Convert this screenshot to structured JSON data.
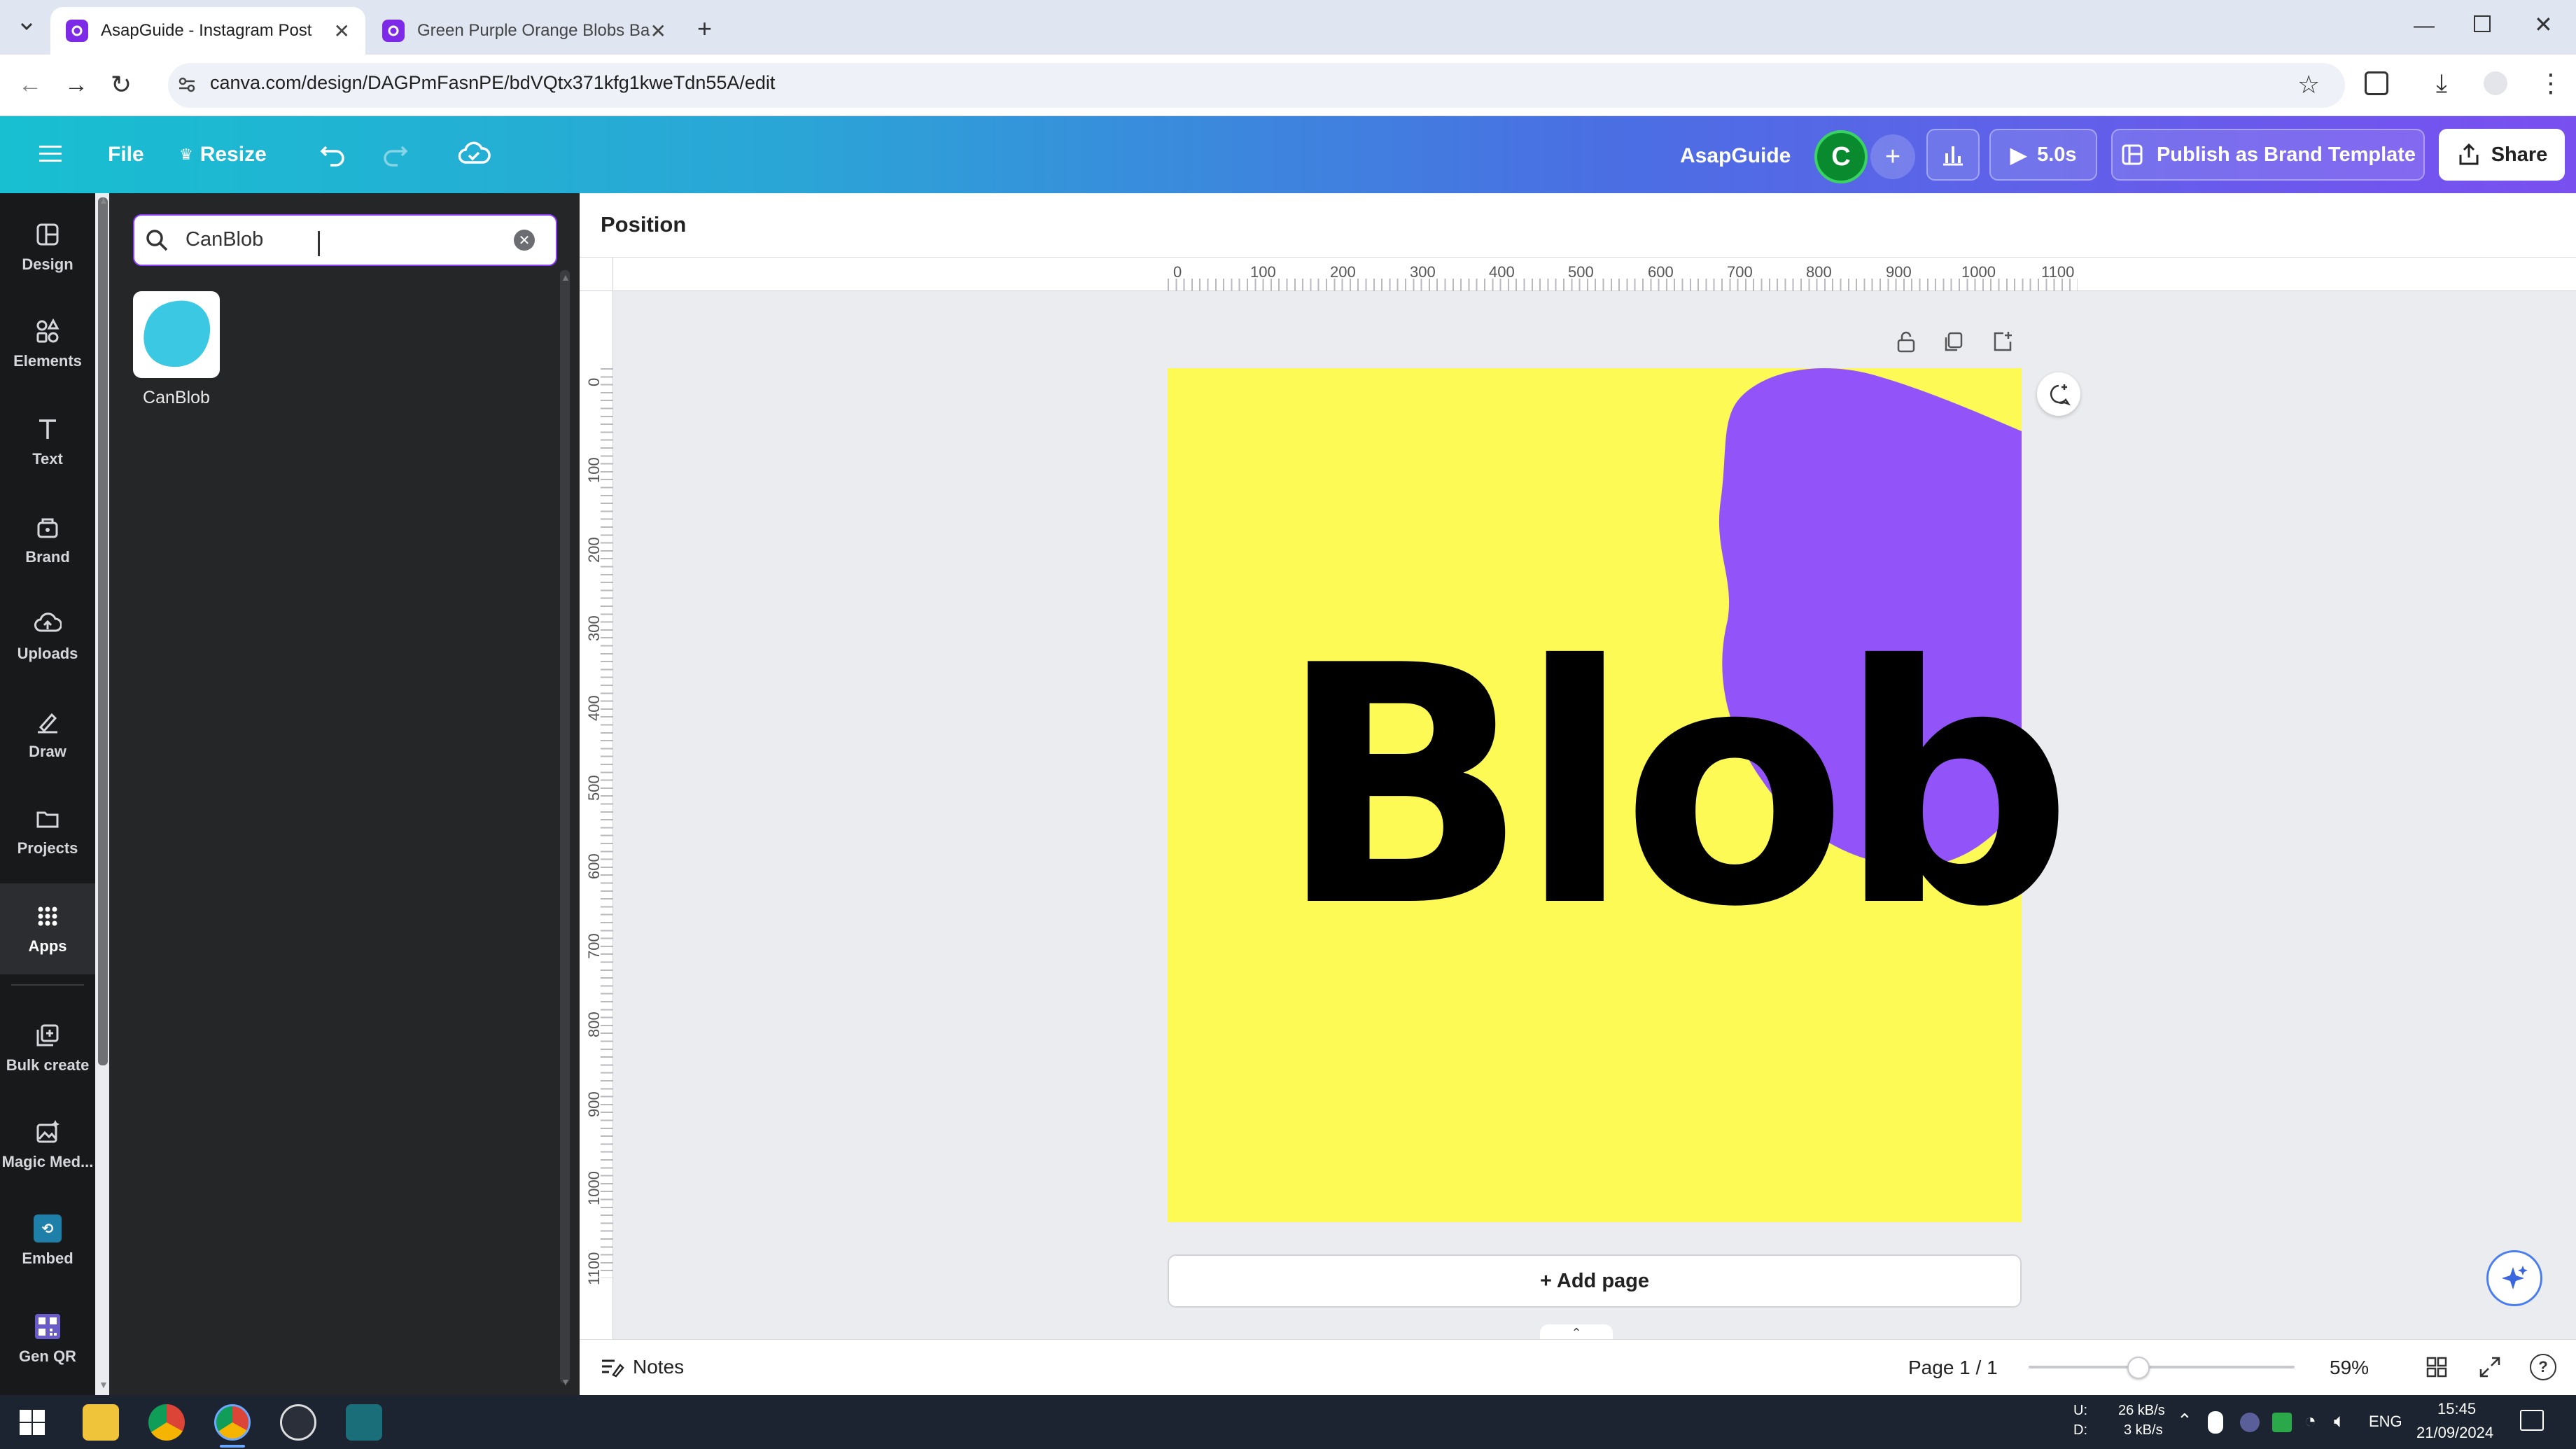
{
  "browser": {
    "tabs": [
      {
        "title": "AsapGuide - Instagram Post",
        "active": true
      },
      {
        "title": "Green Purple Orange Blobs Ba",
        "active": false
      }
    ],
    "url": "canva.com/design/DAGPmFasnPE/bdVQtx371kfg1kweTdn55A/edit"
  },
  "header": {
    "file_label": "File",
    "resize_label": "Resize",
    "team_name": "AsapGuide",
    "avatar_letter": "C",
    "play_duration": "5.0s",
    "publish_label": "Publish as Brand Template",
    "share_label": "Share"
  },
  "rail": {
    "items": [
      {
        "label": "Design",
        "icon": "design-icon"
      },
      {
        "label": "Elements",
        "icon": "elements-icon"
      },
      {
        "label": "Text",
        "icon": "text-icon"
      },
      {
        "label": "Brand",
        "icon": "brand-icon"
      },
      {
        "label": "Uploads",
        "icon": "uploads-icon"
      },
      {
        "label": "Draw",
        "icon": "draw-icon"
      },
      {
        "label": "Projects",
        "icon": "projects-icon"
      },
      {
        "label": "Apps",
        "icon": "apps-icon"
      },
      {
        "label": "Bulk create",
        "icon": "bulk-create-icon"
      },
      {
        "label": "Magic Med...",
        "icon": "magic-media-icon"
      },
      {
        "label": "Embed",
        "icon": "embed-icon"
      },
      {
        "label": "Gen QR",
        "icon": "qr-icon"
      }
    ]
  },
  "panel": {
    "search_value": "CanBlob",
    "result_label": "CanBlob"
  },
  "toolbar": {
    "position_label": "Position"
  },
  "rulers": {
    "h_ticks": [
      "0",
      "100",
      "200",
      "300",
      "400",
      "500",
      "600",
      "700",
      "800",
      "900",
      "1000",
      "1100"
    ],
    "v_ticks": [
      "0",
      "100",
      "200",
      "300",
      "400",
      "500",
      "600",
      "700",
      "800",
      "900",
      "1000",
      "1100"
    ]
  },
  "canvas": {
    "headline": "Blob",
    "background_color": "#fdfa55",
    "blob_color": "#9254f8",
    "add_page_label": "+ Add page"
  },
  "footer": {
    "notes_label": "Notes",
    "page_indicator": "Page 1 / 1",
    "zoom": "59%",
    "zoom_fraction": 0.59
  },
  "taskbar": {
    "net_up": "26 kB/s",
    "net_down": "3 kB/s",
    "net_up_label": "U:",
    "net_down_label": "D:",
    "language": "ENG",
    "time": "15:45",
    "date": "21/09/2024"
  }
}
